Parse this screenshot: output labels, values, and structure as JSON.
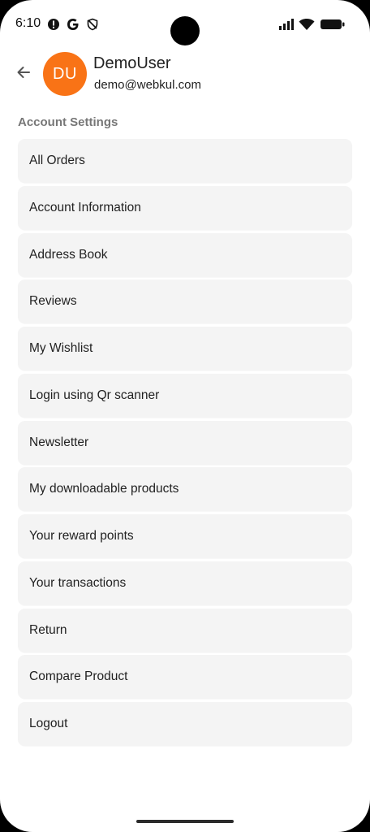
{
  "status_bar": {
    "time": "6:10",
    "left_icons": [
      "alert-circle-icon",
      "google-icon",
      "shield-icon"
    ],
    "right_icons": [
      "signal-icon",
      "wifi-icon",
      "battery-icon"
    ]
  },
  "header": {
    "back_icon": "arrow-left-icon",
    "avatar_initials": "DU",
    "avatar_color": "#f97316",
    "name": "DemoUser",
    "email": "demo@webkul.com"
  },
  "section": {
    "title": "Account Settings"
  },
  "menu": {
    "items": [
      {
        "label": "All Orders"
      },
      {
        "label": "Account Information"
      },
      {
        "label": "Address Book"
      },
      {
        "label": "Reviews"
      },
      {
        "label": "My Wishlist"
      },
      {
        "label": "Login using Qr scanner"
      },
      {
        "label": "Newsletter"
      },
      {
        "label": "My downloadable products"
      },
      {
        "label": "Your reward points"
      },
      {
        "label": "Your transactions"
      },
      {
        "label": "Return"
      },
      {
        "label": "Compare Product"
      },
      {
        "label": "Logout"
      }
    ]
  },
  "colors": {
    "background": "#ffffff",
    "menu_item_bg": "#f4f4f4",
    "section_title": "#777777"
  }
}
